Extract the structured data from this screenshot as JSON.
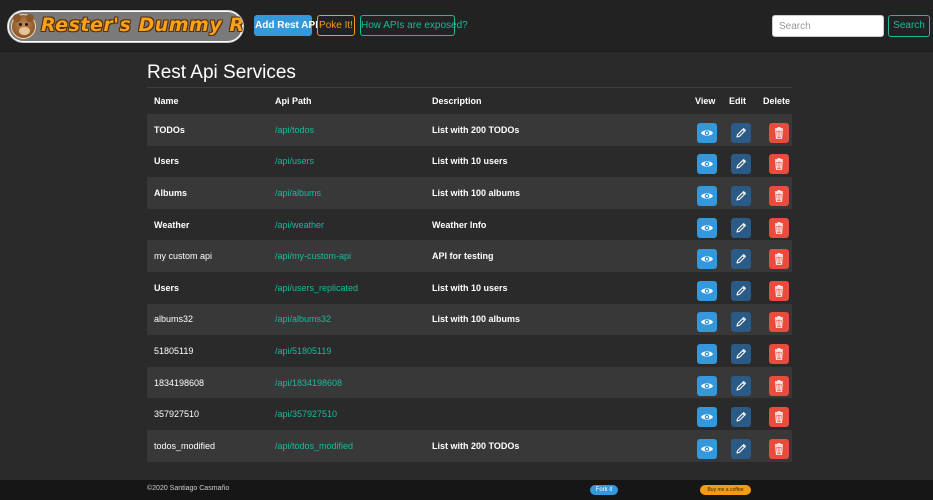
{
  "brand": {
    "title": "Rester's Dummy Run",
    "logo_icon": "bear-logo-icon"
  },
  "navbar": {
    "add_label": "Add Rest API",
    "poke_label": "Poke It!",
    "how_label": "How APIs are exposed?",
    "search_placeholder": "Search",
    "search_button": "Search"
  },
  "main": {
    "title": "Rest Api Services",
    "headers": {
      "name": "Name",
      "path": "Api Path",
      "description": "Description",
      "view": "View",
      "edit": "Edit",
      "delete": "Delete"
    },
    "rows": [
      {
        "name": "TODOs",
        "path": "/api/todos",
        "description": "List with 200 TODOs"
      },
      {
        "name": "Users",
        "path": "/api/users",
        "description": "List with 10 users"
      },
      {
        "name": "Albums",
        "path": "/api/albums",
        "description": "List with 100 albums"
      },
      {
        "name": "Weather",
        "path": "/api/weather",
        "description": "Weather Info"
      },
      {
        "name": "my custom api",
        "path": "/api/my-custom-api",
        "description": "API for testing"
      },
      {
        "name": "Users",
        "path": "/api/users_replicated",
        "description": "List with 10 users"
      },
      {
        "name": "albums32",
        "path": "/api/albums32",
        "description": "List with 100 albums"
      },
      {
        "name": "51805119",
        "path": "/api/51805119",
        "description": ""
      },
      {
        "name": "1834198608",
        "path": "/api/1834198608",
        "description": ""
      },
      {
        "name": "357927510",
        "path": "/api/357927510",
        "description": ""
      },
      {
        "name": "todos_modified",
        "path": "/api/todos_modified",
        "description": "List with 200 TODOs"
      }
    ],
    "icons": {
      "view": "eye-icon",
      "edit": "pencil-icon",
      "delete": "trash-icon"
    }
  },
  "footer": {
    "copyright": "©2020 Santiago Casmaño",
    "fork_label": "Fork it",
    "coffee_label": "Buy me a coffee"
  },
  "colors": {
    "primary": "#3498db",
    "warning": "#f39c12",
    "success": "#18bc9c",
    "danger": "#e74c3c",
    "edit": "#2c5a86"
  }
}
